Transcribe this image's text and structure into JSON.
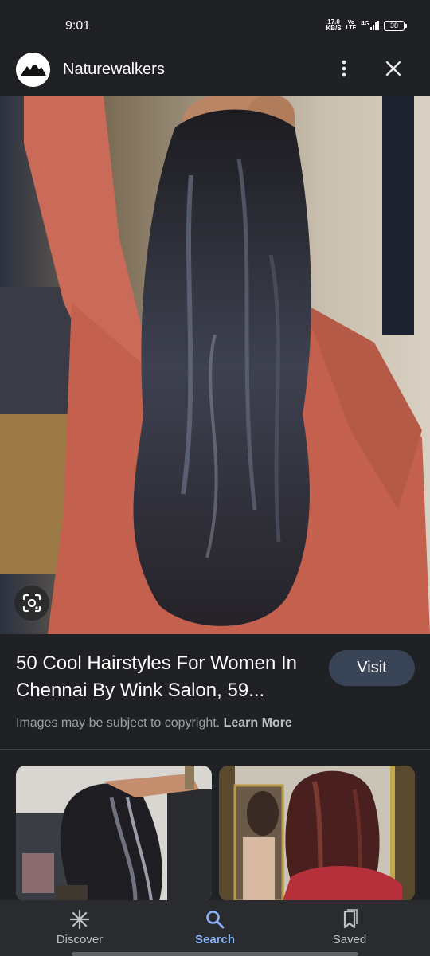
{
  "status_bar": {
    "time": "9:01",
    "net_speed_value": "17.0",
    "net_speed_unit": "KB/S",
    "volte_top": "Vo",
    "volte_bottom": "LTE",
    "network": "4G",
    "battery": "38"
  },
  "header": {
    "site_name": "Naturewalkers",
    "logo_icon": "mountain-logo-icon",
    "more_icon": "more-vert-icon",
    "close_icon": "close-icon"
  },
  "main_image": {
    "lens_icon": "lens-camera-icon"
  },
  "caption": {
    "title": "50 Cool Hairstyles For Women In Chennai By Wink Salon, 59...",
    "visit_label": "Visit",
    "copyright_text": "Images may be subject to copyright.",
    "learn_more": "Learn More"
  },
  "bottom_nav": {
    "items": [
      {
        "label": "Discover",
        "icon": "discover-icon"
      },
      {
        "label": "Search",
        "icon": "search-icon"
      },
      {
        "label": "Saved",
        "icon": "saved-icon"
      }
    ],
    "active": "Search",
    "active_color": "#8ab4f8"
  },
  "colors": {
    "background": "#202124",
    "visit_button": "#394457",
    "nav_background": "#2a2b2f"
  }
}
